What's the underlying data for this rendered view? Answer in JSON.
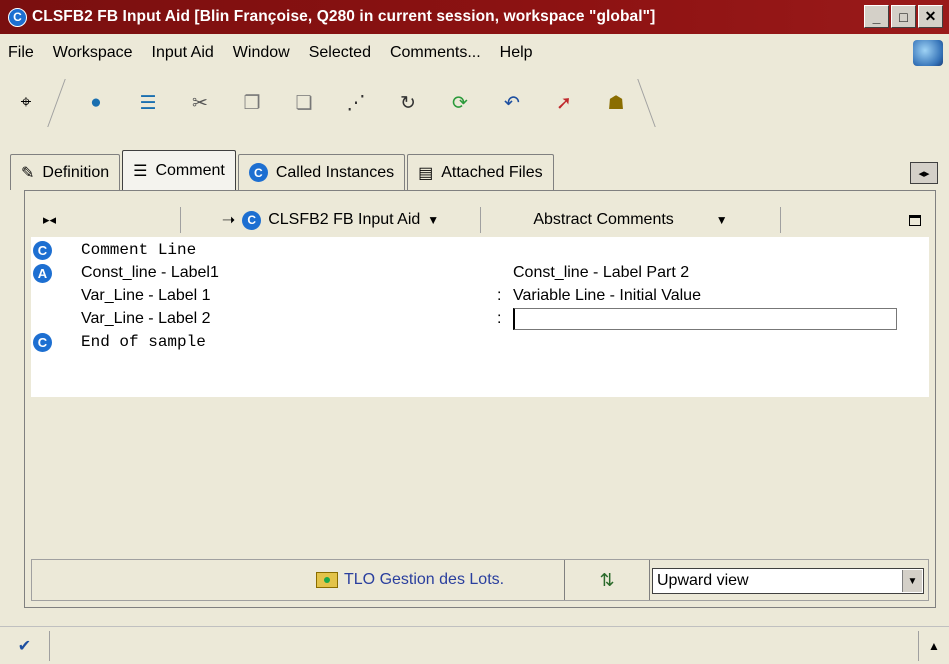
{
  "window": {
    "title": "CLSFB2 FB Input Aid [Blin Françoise, Q280 in current session, workspace \"global\"]",
    "app_icon_letter": "C",
    "controls": [
      "_",
      "□",
      "✕"
    ]
  },
  "menu": {
    "items": [
      "File",
      "Workspace",
      "Input Aid",
      "Window",
      "Selected",
      "Comments...",
      "Help"
    ]
  },
  "toolbar": {
    "icons": [
      "pin-icon",
      "globe-play-icon",
      "list-play-icon",
      "cut-icon",
      "copy-icon",
      "paste-icon",
      "compare-icon",
      "refresh-icon",
      "cycle-icon",
      "undo-icon",
      "arrow-up-right-icon",
      "user-add-icon"
    ]
  },
  "tabs": [
    {
      "label": "Definition",
      "icon": "edit-icon"
    },
    {
      "label": "Comment",
      "icon": "lines-icon",
      "active": true
    },
    {
      "label": "Called Instances",
      "icon": "C"
    },
    {
      "label": "Attached Files",
      "icon": "file-icon"
    }
  ],
  "panel": {
    "header": {
      "instance_label": "CLSFB2 FB Input Aid",
      "instance_icon": "C",
      "view_label": "Abstract Comments"
    },
    "rows": [
      {
        "bullet": "C",
        "left": "Comment Line",
        "mono": true
      },
      {
        "bullet": "A",
        "left": "Const_line - Label1",
        "right": "Const_line - Label Part 2"
      },
      {
        "left": "Var_Line - Label 1",
        "colon": ":",
        "right": "Variable Line - Initial Value"
      },
      {
        "left": "Var_Line - Label 2",
        "colon": ":",
        "input_value": ""
      },
      {
        "bullet": "C",
        "left": "End of sample",
        "mono": true
      }
    ],
    "footer": {
      "link_label": "TLO Gestion des Lots.",
      "view_select": "Upward view"
    }
  },
  "statusbar": {
    "check_icon": "checkmark-icon"
  },
  "colors": {
    "titlebar": "#8d1212",
    "accent_blue": "#1d6fd1",
    "link": "#2a3f9e"
  }
}
